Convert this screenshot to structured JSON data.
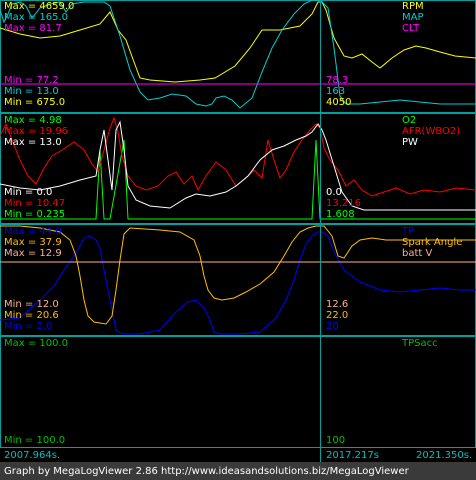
{
  "colors": {
    "rpm": "#ffff00",
    "map": "#00d0d0",
    "clt": "#ff00ff",
    "o2": "#00ff00",
    "afr": "#ff0000",
    "pw": "#ffffff",
    "tp": "#0000ff",
    "spark": "#ffc000",
    "battv": "#ffb090",
    "tpsacc": "#00c000",
    "panel_border": "#00a0a0",
    "separator": "#00a0a0",
    "footer_bg": "#3a3a3a"
  },
  "panels": [
    {
      "id": "panel1",
      "top": 0,
      "height": 113,
      "series": [
        {
          "name": "RPM",
          "color": "#ffff00",
          "max_label": "Max = 4659.0",
          "min_label": "Min = 675.0",
          "cursor_value": "4050"
        },
        {
          "name": "MAP",
          "color": "#00d0d0",
          "max_label": "Max = 165.0",
          "min_label": "Min = 13.0",
          "cursor_value": "163"
        },
        {
          "name": "CLT",
          "color": "#ff00ff",
          "max_label": "Max = 81.7",
          "min_label": "Min = 77.2",
          "cursor_value": "78.3"
        }
      ]
    },
    {
      "id": "panel2",
      "top": 113,
      "height": 111,
      "series": [
        {
          "name": "O2",
          "color": "#00ff00",
          "max_label": "Max = 4.98",
          "min_label": "Min = 0.235",
          "cursor_value": "1.608"
        },
        {
          "name": "AFR(WBO2)",
          "color": "#ff0000",
          "max_label": "Max = 19.96",
          "min_label": "Min = 10.47",
          "cursor_value": "13.216"
        },
        {
          "name": "PW",
          "color": "#ffffff",
          "max_label": "Max = 13.0",
          "min_label": "Min = 0.0",
          "cursor_value": "0.0"
        }
      ]
    },
    {
      "id": "panel3",
      "top": 224,
      "height": 112,
      "series": [
        {
          "name": "TP",
          "color": "#0000ff",
          "max_label": "Max = 44.0",
          "min_label": "Min = 2.0",
          "cursor_value": "20"
        },
        {
          "name": "Spark Angle",
          "color": "#ffc000",
          "max_label": "Max = 37.9",
          "min_label": "Min = 20.6",
          "cursor_value": "22.0"
        },
        {
          "name": "batt V",
          "color": "#ffb090",
          "max_label": "Max = 12.9",
          "min_label": "Min = 12.0",
          "cursor_value": "12.6"
        }
      ]
    },
    {
      "id": "panel4",
      "top": 336,
      "height": 112,
      "series": [
        {
          "name": "TPSacc",
          "color": "#00c000",
          "max_label": "Max = 100.0",
          "min_label": "Min = 100.0",
          "cursor_value": "100"
        }
      ]
    }
  ],
  "timeline": {
    "start": "2007.964s.",
    "cursor": "2017.217s",
    "end": "2021.350s."
  },
  "footer": {
    "text": "Graph by MegaLogViewer 2.86 http://www.ideasandsolutions.biz/MegaLogViewer"
  }
}
